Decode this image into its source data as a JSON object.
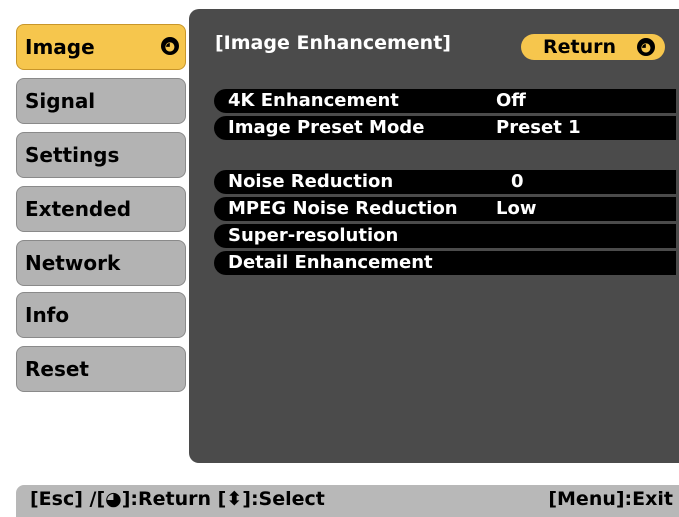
{
  "sidebar": {
    "items": [
      {
        "label": "Image",
        "selected": true
      },
      {
        "label": "Signal"
      },
      {
        "label": "Settings"
      },
      {
        "label": "Extended"
      },
      {
        "label": "Network"
      },
      {
        "label": "Info"
      },
      {
        "label": "Reset"
      }
    ]
  },
  "content": {
    "title": "[Image Enhancement]",
    "return_label": "Return",
    "group1": [
      {
        "label": "4K Enhancement",
        "value": "Off"
      },
      {
        "label": "Image Preset Mode",
        "value": "Preset 1"
      }
    ],
    "group2": [
      {
        "label": "Noise Reduction",
        "value": "0"
      },
      {
        "label": "MPEG Noise Reduction",
        "value": "Low"
      },
      {
        "label": "Super-resolution",
        "value": ""
      },
      {
        "label": "Detail Enhancement",
        "value": ""
      }
    ]
  },
  "footer": {
    "left": "[Esc] /[◕]:Return  [⬍]:Select",
    "right": "[Menu]:Exit"
  },
  "colors": {
    "selected": "#f6c64d",
    "panel": "#4b4b4b",
    "row": "#000000",
    "menu": "#b3b3b3"
  }
}
